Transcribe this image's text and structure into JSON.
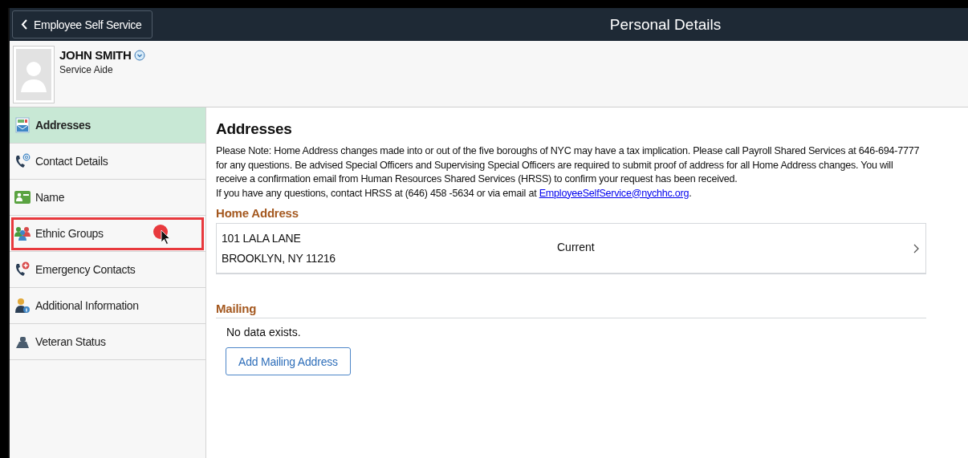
{
  "header": {
    "back_button": "Employee Self Service",
    "title": "Personal Details"
  },
  "profile": {
    "name": "JOHN SMITH",
    "job_title": "Service Aide"
  },
  "sidebar": {
    "items": [
      {
        "label": "Addresses",
        "selected": true,
        "highlighted": false
      },
      {
        "label": "Contact Details",
        "selected": false,
        "highlighted": false
      },
      {
        "label": "Name",
        "selected": false,
        "highlighted": false
      },
      {
        "label": "Ethnic Groups",
        "selected": false,
        "highlighted": true
      },
      {
        "label": "Emergency Contacts",
        "selected": false,
        "highlighted": false
      },
      {
        "label": "Additional Information",
        "selected": false,
        "highlighted": false
      },
      {
        "label": "Veteran Status",
        "selected": false,
        "highlighted": false
      }
    ]
  },
  "content": {
    "title": "Addresses",
    "notice": "Please Note: Home Address changes made into or out of the five boroughs of NYC may have a tax implication. Please call Payroll Shared Services at 646-694-7777 for any questions. Be advised Special Officers and Supervising Special Officers are required to submit proof of address for all Home Address changes. You will receive a confirmation email from Human Resources Shared Services (HRSS) to confirm your request has been received.",
    "contact_line": "If you have any questions, contact HRSS at (646) 458 -5634 or via email at",
    "email_link": "EmployeeSelfService@nychhc.org",
    "contact_suffix": ".",
    "home_address": {
      "heading": "Home Address",
      "lines": [
        "101 LALA LANE",
        "BROOKLYN, NY 11216"
      ],
      "status": "Current"
    },
    "mailing": {
      "heading": "Mailing",
      "empty_message": "No data exists.",
      "add_button": "Add Mailing Address"
    }
  }
}
